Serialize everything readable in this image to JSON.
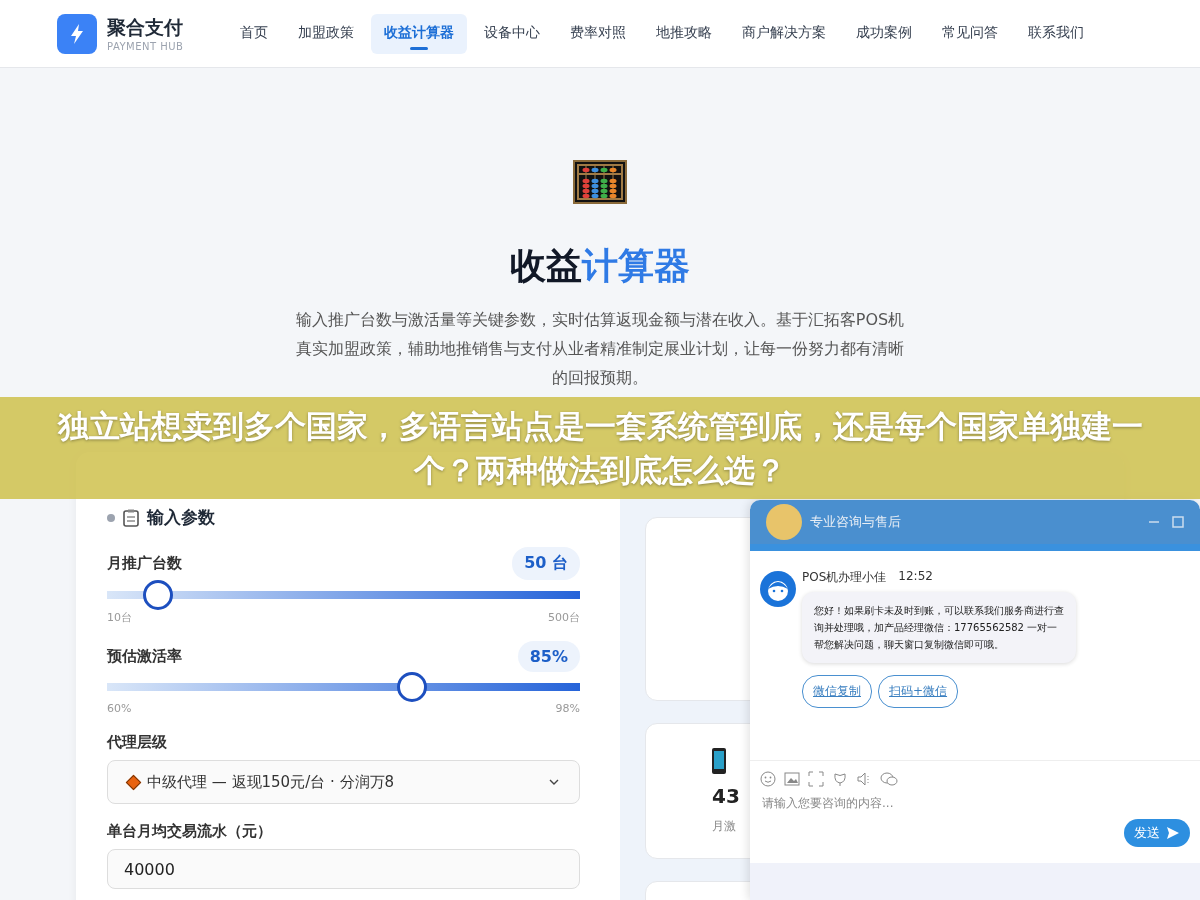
{
  "nav": {
    "logo_title": "聚合支付",
    "logo_subtitle": "PAYMENT HUB",
    "items": [
      {
        "label": "首页",
        "selected": false
      },
      {
        "label": "加盟政策",
        "selected": false
      },
      {
        "label": "收益计算器",
        "selected": true
      },
      {
        "label": "设备中心",
        "selected": false
      },
      {
        "label": "费率对照",
        "selected": false
      },
      {
        "label": "地推攻略",
        "selected": false
      },
      {
        "label": "商户解决方案",
        "selected": false
      },
      {
        "label": "成功案例",
        "selected": false
      },
      {
        "label": "常见问答",
        "selected": false
      },
      {
        "label": "联系我们",
        "selected": false
      }
    ]
  },
  "hero": {
    "title_main": "收益",
    "title_accent": "计算器",
    "description": "输入推广台数与激活量等关键参数，实时估算返现金额与潜在收入。基于汇拓客POS机真实加盟政策，辅助地推销售与支付从业者精准制定展业计划，让每一份努力都有清晰的回报预期。"
  },
  "input_panel": {
    "heading": "输入参数",
    "sliders": [
      {
        "label": "月推广台数",
        "value": "50 台",
        "min": "10台",
        "max": "500台",
        "level": 0.108
      },
      {
        "label": "预估激活率",
        "value": "85%",
        "min": "60%",
        "max": "98%",
        "level": 0.645
      }
    ],
    "agent_level": {
      "label": "代理层级",
      "value": "中级代理 — 返现150元/台 · 分润万8"
    },
    "monthly_volume": {
      "label": "单台月均交易流水（元）",
      "value": "40000"
    }
  },
  "stat_card": {
    "value": "43",
    "label": "月激"
  },
  "chat": {
    "title": "专业咨询与售后",
    "agent": "POS机办理小佳",
    "time": "12:52",
    "message": "您好！如果刷卡未及时到账，可以联系我们服务商进行查询并处理哦，加产品经理微信：17765562582 一对一帮您解决问题，聊天窗口复制微信即可哦。",
    "actions": [
      "微信复制",
      "扫码+微信"
    ],
    "placeholder": "请输入您要咨询的内容...",
    "send": "发送"
  },
  "banner": {
    "text": "独立站想卖到多个国家，多语言站点是一套系统管到底，还是每个国家单独建一个？两种做法到底怎么选？"
  }
}
